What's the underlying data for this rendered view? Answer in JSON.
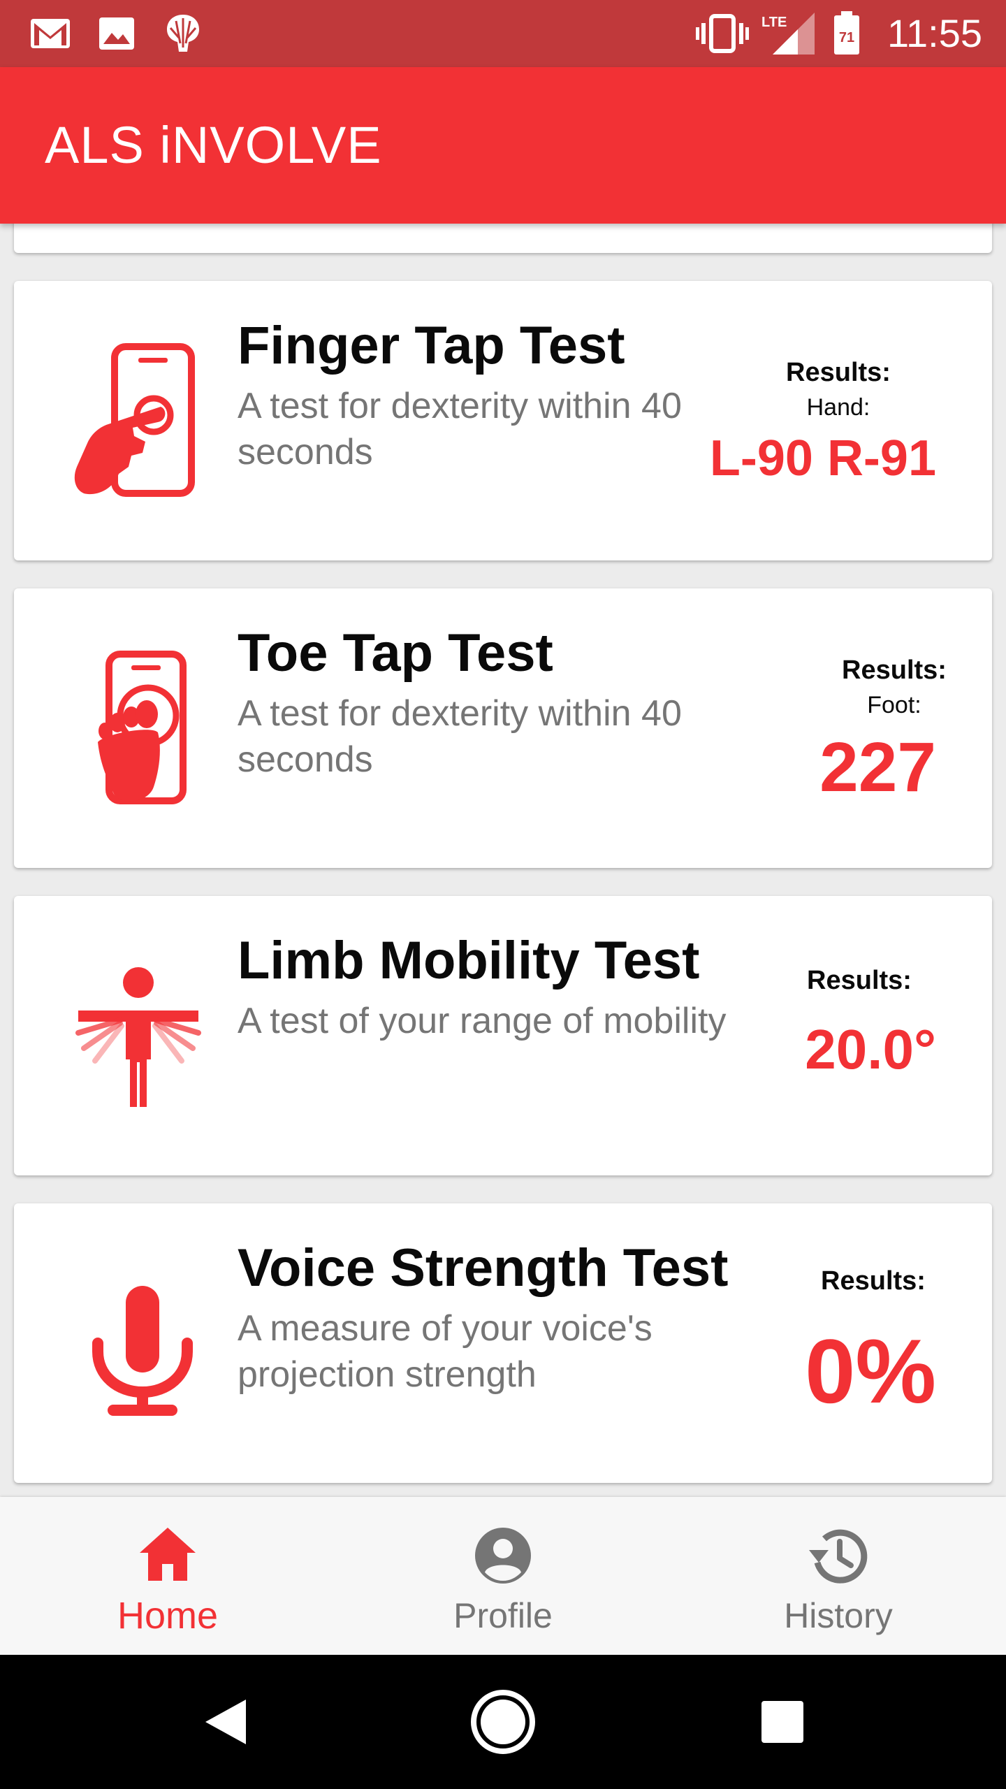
{
  "status_bar": {
    "time": "11:55",
    "network": "LTE",
    "battery_level": "71",
    "notification_icons": [
      "gmail-icon",
      "image-icon",
      "app-notification-icon"
    ],
    "right_icons": [
      "vibrate-icon",
      "lte-signal-icon",
      "battery-icon"
    ]
  },
  "app_bar": {
    "title": "ALS iNVOLVE"
  },
  "cards": [
    {
      "title": "Finger Tap Test",
      "description": "A test for dexterity within 40 seconds",
      "results_label": "Results:",
      "results_sub": "Hand:",
      "results_value": "L-90 R-91",
      "icon": "finger-tap-phone-icon"
    },
    {
      "title": "Toe Tap Test",
      "description": "A test for dexterity within 40 seconds",
      "results_label": "Results:",
      "results_sub": "Foot:",
      "results_value": "227",
      "icon": "foot-tap-phone-icon"
    },
    {
      "title": "Limb Mobility Test",
      "description": "A test of your range of mobility",
      "results_label": "Results:",
      "results_value": "20.0°",
      "icon": "limb-mobility-icon"
    },
    {
      "title": "Voice Strength Test",
      "description": "A measure of your voice's projection strength",
      "results_label": "Results:",
      "results_value": "0%",
      "icon": "microphone-icon"
    }
  ],
  "bottom_nav": {
    "items": [
      {
        "label": "Home",
        "icon": "home-icon",
        "active": true
      },
      {
        "label": "Profile",
        "icon": "account-icon",
        "active": false
      },
      {
        "label": "History",
        "icon": "history-icon",
        "active": false
      }
    ]
  },
  "system_nav": [
    "back-icon",
    "home-circle-icon",
    "recents-icon"
  ],
  "colors": {
    "accent": "#f23135",
    "status_bar": "#c0393b",
    "inactive_nav": "#757575",
    "description_text": "#757575"
  }
}
